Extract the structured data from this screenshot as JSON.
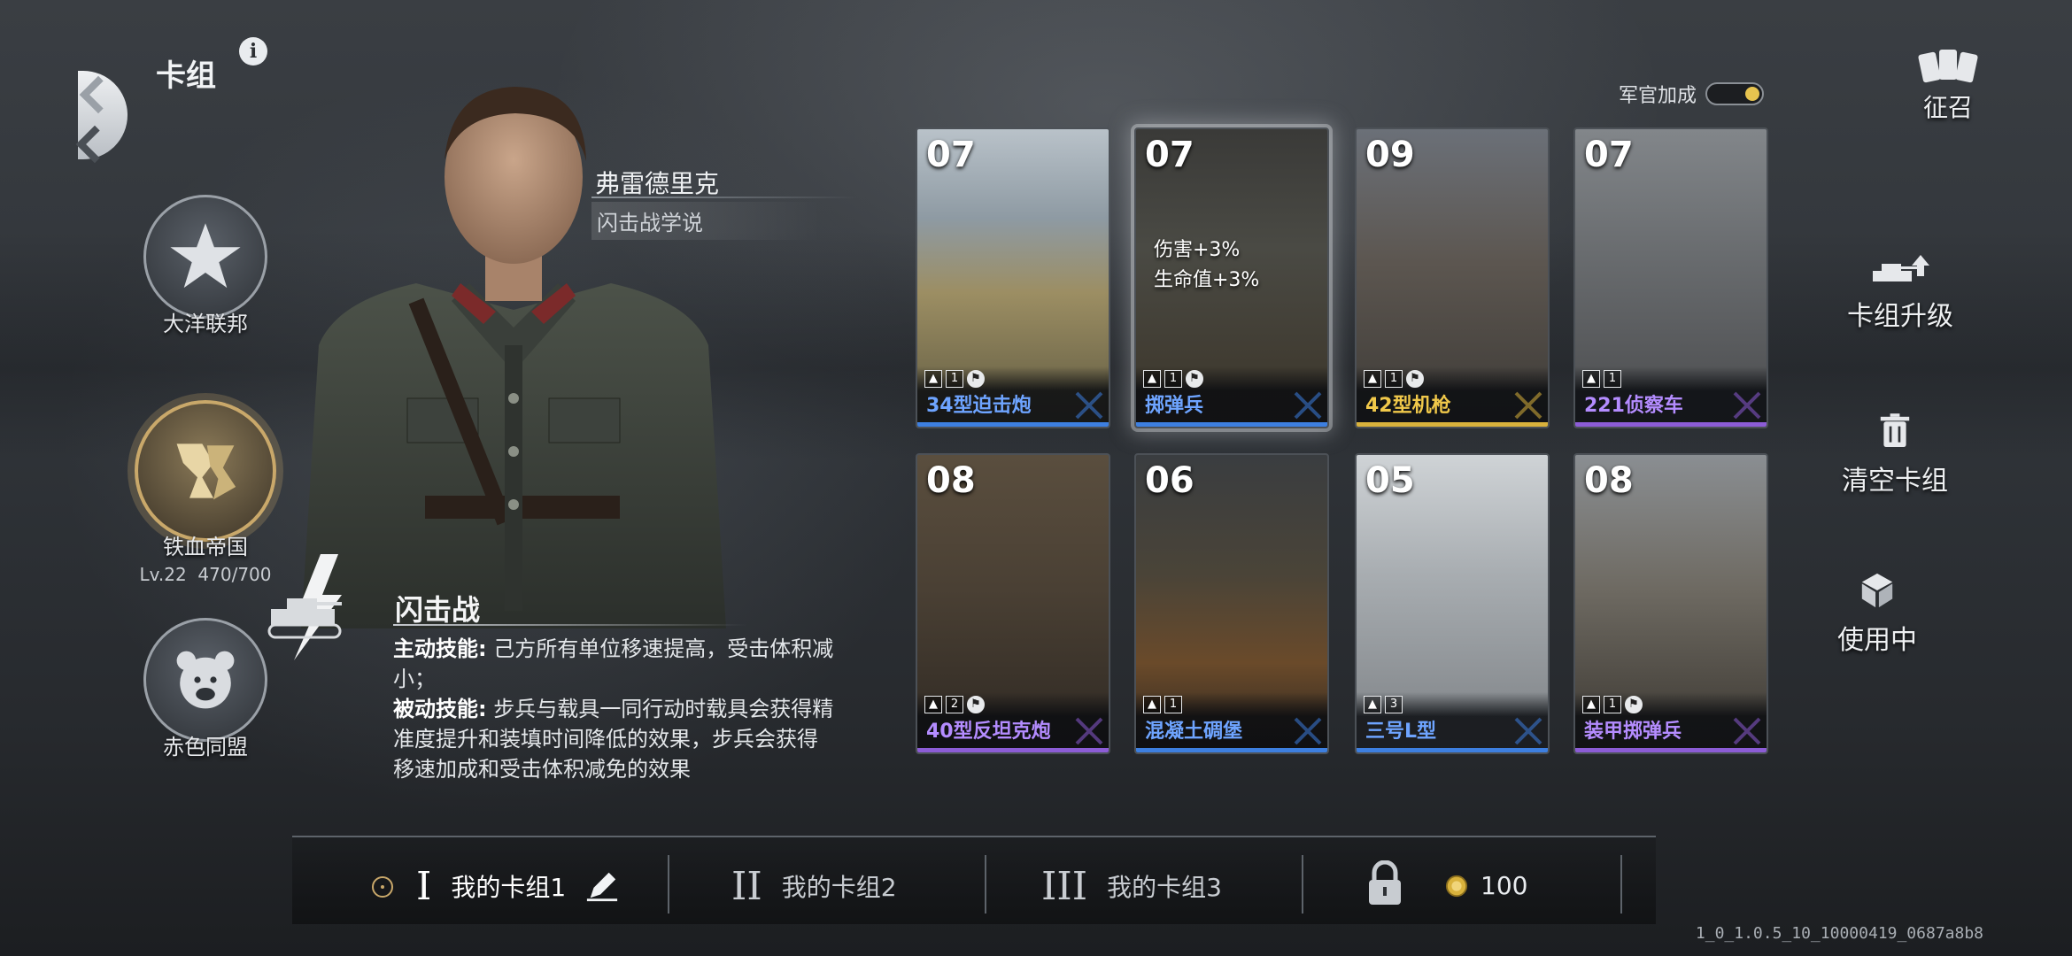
{
  "header": {
    "title": "卡组",
    "info_icon": "info-icon"
  },
  "factions": [
    {
      "name": "大洋联邦",
      "icon": "star-emblem-icon",
      "active": false
    },
    {
      "name": "铁血帝国",
      "icon": "lion-emblem-icon",
      "active": true,
      "level": "Lv.22",
      "xp": "470/700"
    },
    {
      "name": "赤色同盟",
      "icon": "bear-emblem-icon",
      "active": false
    }
  ],
  "officer": {
    "name": "弗雷德里克",
    "doctrine": "闪击战学说",
    "skill": {
      "title": "闪击战",
      "active_label": "主动技能:",
      "active_text": "己方所有单位移速提高，受击体积减小；",
      "passive_label": "被动技能:",
      "passive_text": "步兵与载具一同行动时载具会获得精准度提升和装填时间降低的效果，步兵会获得移速加成和受击体积减免的效果"
    }
  },
  "officer_bonus": {
    "label": "军官加成",
    "enabled": true
  },
  "cards": [
    {
      "cost": "07",
      "name": "34型迫击炮",
      "rarity": "blue",
      "count": "1",
      "type_icon": "mortar-icon",
      "buff": []
    },
    {
      "cost": "07",
      "name": "掷弹兵",
      "rarity": "blue",
      "count": "1",
      "type_icon": "infantry-icon",
      "buff": [
        "伤害+3%",
        "生命值+3%"
      ],
      "selected": true
    },
    {
      "cost": "09",
      "name": "42型机枪",
      "rarity": "gold",
      "count": "1",
      "type_icon": "machine-gun-icon",
      "buff": []
    },
    {
      "cost": "07",
      "name": "221侦察车",
      "rarity": "purple",
      "count": "1",
      "type_icon": "armored-car-icon",
      "buff": []
    },
    {
      "cost": "08",
      "name": "40型反坦克炮",
      "rarity": "purple",
      "count": "2",
      "type_icon": "anti-tank-gun-icon",
      "buff": []
    },
    {
      "cost": "06",
      "name": "混凝土碉堡",
      "rarity": "blue",
      "count": "1",
      "type_icon": "bunker-icon",
      "buff": []
    },
    {
      "cost": "05",
      "name": "三号L型",
      "rarity": "blue",
      "count": "3",
      "type_icon": "tank-icon",
      "buff": []
    },
    {
      "cost": "08",
      "name": "装甲掷弹兵",
      "rarity": "purple",
      "count": "1",
      "type_icon": "armored-infantry-icon",
      "buff": []
    }
  ],
  "colors": {
    "blue": "#3d7fe0",
    "gold": "#d9b23c",
    "purple": "#8c5cd6",
    "blue_text": "#6ea4ff",
    "gold_text": "#f0c84a",
    "purple_text": "#b48cff"
  },
  "side_actions": {
    "recruit": "征召",
    "upgrade": "卡组升级",
    "clear": "清空卡组",
    "in_use": "使用中"
  },
  "deck_tabs": [
    {
      "roman": "I",
      "label": "我的卡组1",
      "active": true
    },
    {
      "roman": "II",
      "label": "我的卡组2",
      "active": false
    },
    {
      "roman": "III",
      "label": "我的卡组3",
      "active": false
    }
  ],
  "currency": {
    "amount": "100"
  },
  "version": "1_0_1.0.5_10_10000419_0687a8b8"
}
